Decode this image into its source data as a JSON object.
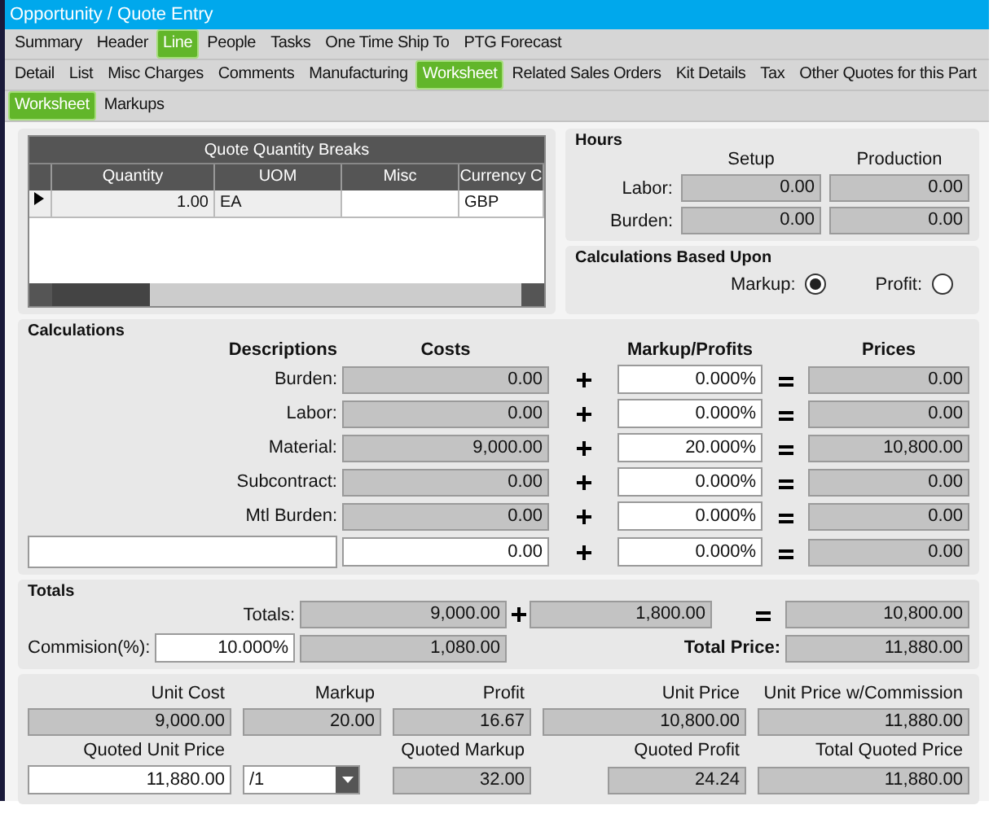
{
  "window": {
    "title": "Opportunity / Quote Entry"
  },
  "tab_rows": [
    [
      {
        "label": "Summary",
        "selected": false
      },
      {
        "label": "Header",
        "selected": false
      },
      {
        "label": "Line",
        "selected": true
      },
      {
        "label": "People",
        "selected": false
      },
      {
        "label": "Tasks",
        "selected": false
      },
      {
        "label": "One Time Ship To",
        "selected": false
      },
      {
        "label": "PTG Forecast",
        "selected": false
      }
    ],
    [
      {
        "label": "Detail",
        "selected": false
      },
      {
        "label": "List",
        "selected": false
      },
      {
        "label": "Misc Charges",
        "selected": false
      },
      {
        "label": "Comments",
        "selected": false
      },
      {
        "label": "Manufacturing",
        "selected": false
      },
      {
        "label": "Worksheet",
        "selected": true
      },
      {
        "label": "Related Sales Orders",
        "selected": false
      },
      {
        "label": "Kit Details",
        "selected": false
      },
      {
        "label": "Tax",
        "selected": false
      },
      {
        "label": "Other Quotes for this Part",
        "selected": false
      }
    ],
    [
      {
        "label": "Worksheet",
        "selected": true
      },
      {
        "label": "Markups",
        "selected": false
      }
    ]
  ],
  "quantity_breaks": {
    "title": "Quote Quantity Breaks",
    "columns": [
      "Quantity",
      "UOM",
      "Misc",
      "Currency C"
    ],
    "rows": [
      {
        "selected": true,
        "cells": [
          "1.00",
          "EA",
          "",
          "GBP"
        ]
      }
    ]
  },
  "hours": {
    "title": "Hours",
    "columns": [
      "Setup",
      "Production"
    ],
    "rows": [
      {
        "label": "Labor:",
        "values": [
          "0.00",
          "0.00"
        ]
      },
      {
        "label": "Burden:",
        "values": [
          "0.00",
          "0.00"
        ]
      }
    ]
  },
  "calculations_based_upon": {
    "title": "Calculations Based Upon",
    "options": [
      {
        "label": "Markup:",
        "selected": true
      },
      {
        "label": "Profit:",
        "selected": false
      }
    ]
  },
  "calculations": {
    "title": "Calculations",
    "headers": [
      "Descriptions",
      "Costs",
      "Markup/Profits",
      "Prices"
    ],
    "rows": [
      {
        "kind": "fixed",
        "label": "Burden:",
        "cost": "0.00",
        "markup": "0.000%",
        "price": "0.00"
      },
      {
        "kind": "fixed",
        "label": "Labor:",
        "cost": "0.00",
        "markup": "0.000%",
        "price": "0.00"
      },
      {
        "kind": "fixed",
        "label": "Material:",
        "cost": "9,000.00",
        "markup": "20.000%",
        "price": "10,800.00"
      },
      {
        "kind": "fixed",
        "label": "Subcontract:",
        "cost": "0.00",
        "markup": "0.000%",
        "price": "0.00"
      },
      {
        "kind": "fixed",
        "label": "Mtl Burden:",
        "cost": "0.00",
        "markup": "0.000%",
        "price": "0.00"
      },
      {
        "kind": "custom",
        "cost": "0.00",
        "markup": "0.000%",
        "price": "0.00"
      }
    ]
  },
  "totals": {
    "title": "Totals",
    "label": "Totals:",
    "cost": "9,000.00",
    "markup": "1,800.00",
    "price": "10,800.00",
    "commission_label": "Commision(%):",
    "commission_percent": "10.000%",
    "commission_amount": "1,080.00",
    "total_price_label": "Total Price:",
    "total_price": "11,880.00"
  },
  "summary": {
    "row_1": [
      {
        "label": "Unit Cost",
        "value": "9,000.00"
      },
      {
        "label": "Markup",
        "value": "20.00"
      },
      {
        "label": "Profit",
        "value": "16.67"
      },
      {
        "label": "Unit Price",
        "value": "10,800.00"
      },
      {
        "label": "Unit Price w/Commission",
        "value": "11,880.00"
      }
    ],
    "quoted_unit_price": {
      "label": "Quoted Unit Price",
      "value": "11,880.00"
    },
    "price_per": "/1",
    "quoted_markup": {
      "label": "Quoted Markup",
      "value": "32.00"
    },
    "quoted_profit": {
      "label": "Quoted Profit",
      "value": "24.24"
    },
    "total_quoted_price": {
      "label": "Total Quoted Price",
      "value": "11,880.00"
    }
  }
}
